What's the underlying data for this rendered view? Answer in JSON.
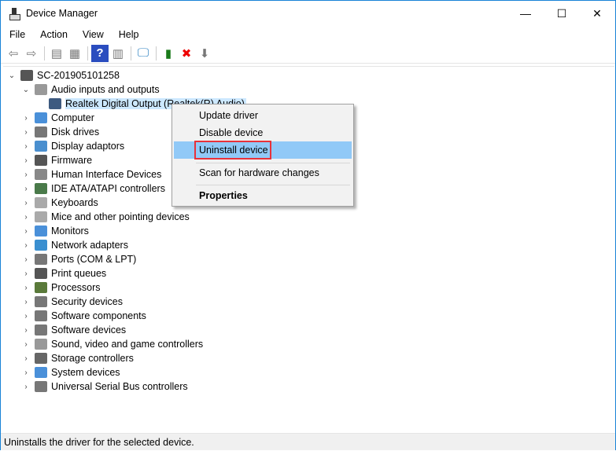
{
  "window": {
    "title": "Device Manager",
    "minimize": "—",
    "maximize": "☐",
    "close": "✕"
  },
  "menu": [
    "File",
    "Action",
    "View",
    "Help"
  ],
  "toolbar": [
    {
      "name": "back-icon",
      "glyph": "⇦"
    },
    {
      "name": "forward-icon",
      "glyph": "⇨"
    },
    {
      "name": "show-hide-console-tree-icon",
      "glyph": "▤"
    },
    {
      "name": "properties-icon",
      "glyph": "▦"
    },
    {
      "name": "help-icon",
      "glyph": "?"
    },
    {
      "name": "action-pane-icon",
      "glyph": "▥"
    },
    {
      "name": "scan-hardware-icon",
      "glyph": "🖵"
    },
    {
      "name": "update-driver-icon",
      "glyph": "▮"
    },
    {
      "name": "uninstall-icon",
      "glyph": "✖"
    },
    {
      "name": "disable-device-icon",
      "glyph": "⬇"
    }
  ],
  "tree": {
    "root": "SC-201905101258",
    "audio": "Audio inputs and outputs",
    "audio_child": "Realtek Digital Output (Realtek(R) Audio)",
    "categories": [
      "Computer",
      "Disk drives",
      "Display adaptors",
      "Firmware",
      "Human Interface Devices",
      "IDE ATA/ATAPI controllers",
      "Keyboards",
      "Mice and other pointing devices",
      "Monitors",
      "Network adapters",
      "Ports (COM & LPT)",
      "Print queues",
      "Processors",
      "Security devices",
      "Software components",
      "Software devices",
      "Sound, video and game controllers",
      "Storage controllers",
      "System devices",
      "Universal Serial Bus controllers"
    ]
  },
  "context_menu": {
    "update": "Update driver",
    "disable": "Disable device",
    "uninstall": "Uninstall device",
    "scan": "Scan for hardware changes",
    "properties": "Properties"
  },
  "status": "Uninstalls the driver for the selected device.",
  "colors": {
    "selection": "#cce8ff",
    "menu_highlight": "#91c9f7",
    "highlight_box": "#e8313a",
    "border": "#1883d7"
  }
}
